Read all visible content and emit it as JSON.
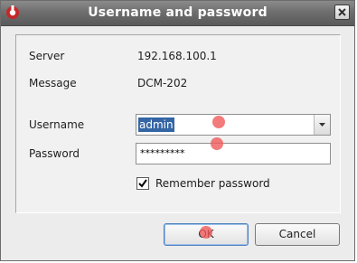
{
  "window": {
    "title": "Username and password"
  },
  "form": {
    "server_label": "Server",
    "server_value": "192.168.100.1",
    "message_label": "Message",
    "message_value": "DCM-202",
    "username_label": "Username",
    "username_value": "admin",
    "password_label": "Password",
    "password_value": "*********",
    "remember_label": "Remember password",
    "remember_checked": true
  },
  "buttons": {
    "ok": "OK",
    "cancel": "Cancel"
  },
  "icons": {
    "app": "app-logo-icon",
    "close": "close-icon",
    "dropdown": "chevron-down-icon",
    "check": "checkmark-icon"
  },
  "colors": {
    "titlebar": "#6e6e6e",
    "selection": "#3465a4",
    "marker": "#f05a5a"
  }
}
